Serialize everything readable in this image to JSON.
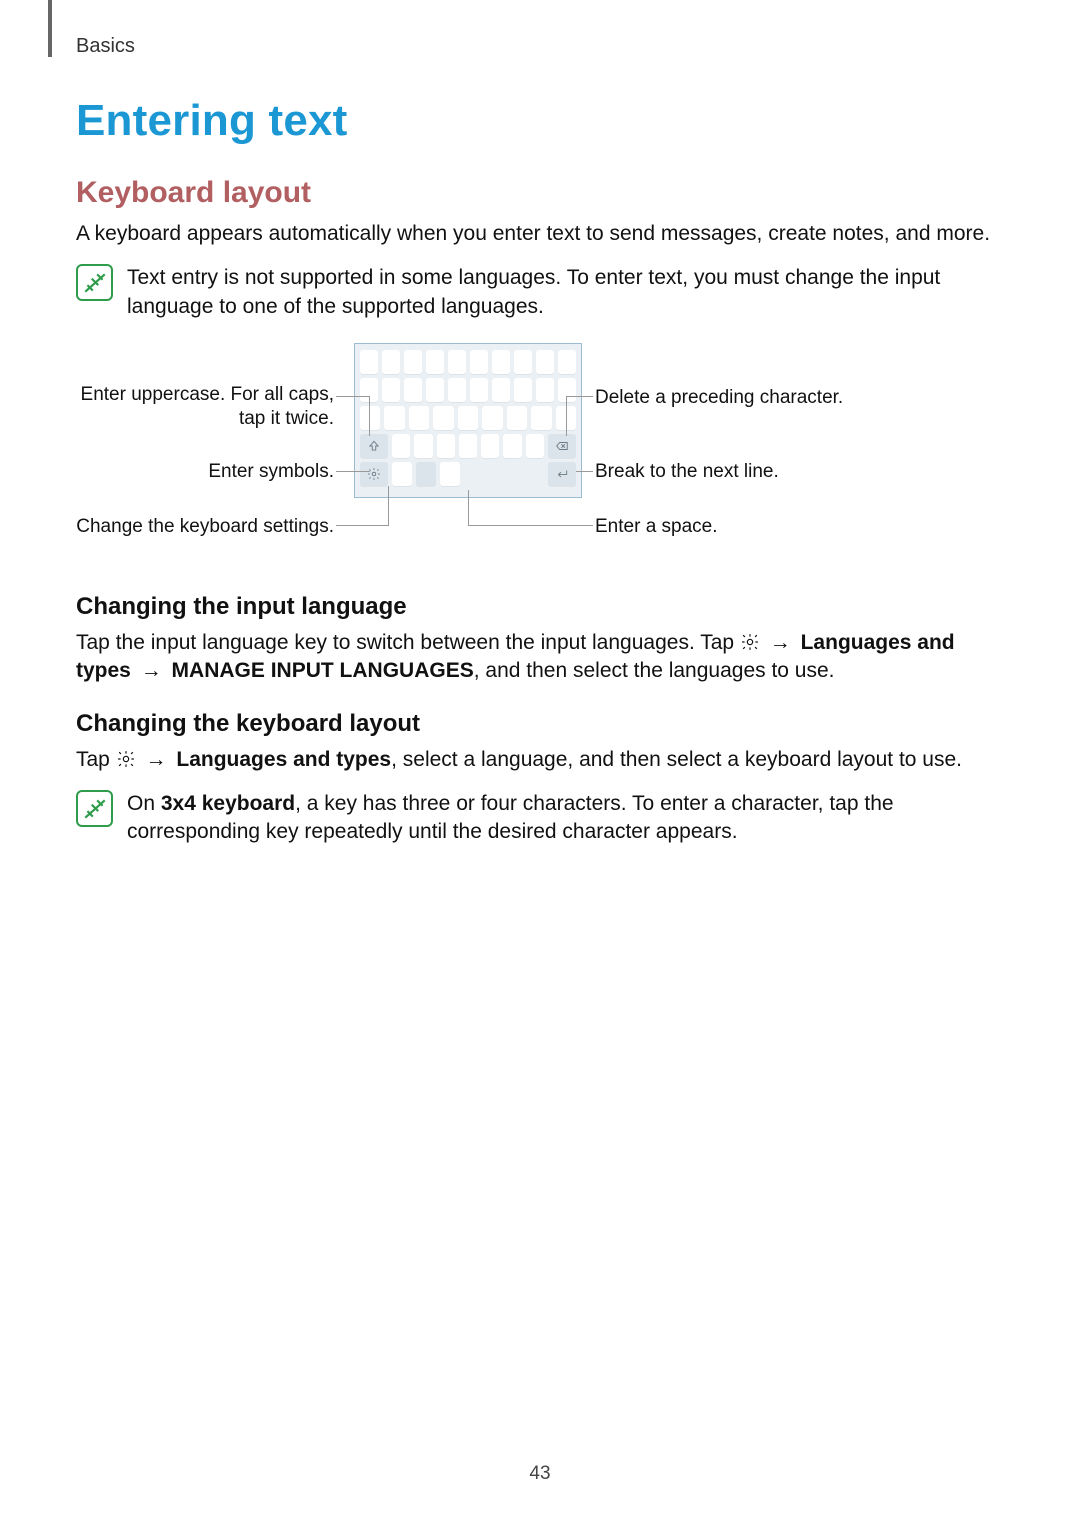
{
  "header": {
    "section": "Basics"
  },
  "title": "Entering text",
  "subtitle": "Keyboard layout",
  "intro": "A keyboard appears automatically when you enter text to send messages, create notes, and more.",
  "note1": "Text entry is not supported in some languages. To enter text, you must change the input language to one of the supported languages.",
  "callouts": {
    "shift": "Enter uppercase. For all caps, tap it twice.",
    "symbols": "Enter symbols.",
    "settings": "Change the keyboard settings.",
    "delete": "Delete a preceding character.",
    "enter": "Break to the next line.",
    "space": "Enter a space."
  },
  "sec1": {
    "heading": "Changing the input language",
    "p_pre": "Tap the input language key to switch between the input languages. Tap ",
    "arrow": "→",
    "bold1": "Languages and types",
    "bold2": "MANAGE INPUT LANGUAGES",
    "p_post": ", and then select the languages to use."
  },
  "sec2": {
    "heading": "Changing the keyboard layout",
    "p_pre": "Tap ",
    "arrow": "→",
    "bold1": "Languages and types",
    "p_post": ", select a language, and then select a keyboard layout to use."
  },
  "note2": {
    "pre": "On ",
    "bold": "3x4 keyboard",
    "post": ", a key has three or four characters. To enter a character, tap the corresponding key repeatedly until the desired character appears."
  },
  "page_number": "43"
}
